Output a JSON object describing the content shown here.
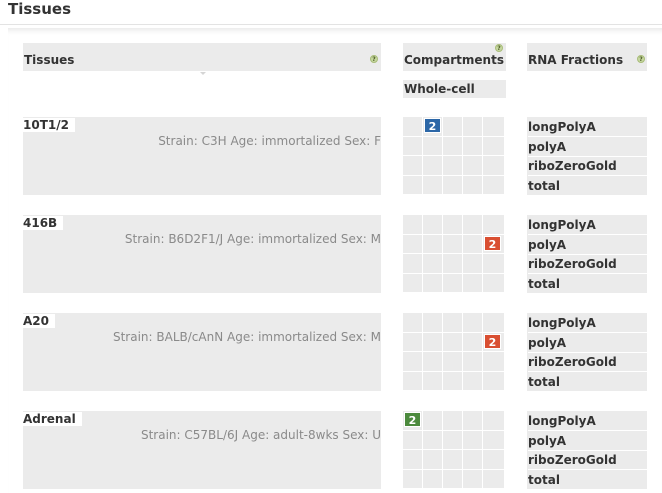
{
  "page": {
    "title": "Tissues"
  },
  "header": {
    "tissues_label": "Tissues",
    "compartments_label": "Compartments",
    "rna_label": "RNA Fractions",
    "help_glyph": "?",
    "compartment_column": "Whole-cell"
  },
  "colors": {
    "blue": "#2c67a7",
    "red": "#d94f32",
    "green": "#4c8a3d",
    "header_bg": "#ebebeb"
  },
  "rows": [
    {
      "name": "10T1/2",
      "desc": "Strain: C3H Age: immortalized Sex: F",
      "fractions": [
        "longPolyA",
        "polyA",
        "riboZeroGold",
        "total"
      ],
      "badge": {
        "text": "2",
        "color": "blue",
        "row": 0,
        "col": 1
      }
    },
    {
      "name": "416B",
      "desc": "Strain: B6D2F1/J Age: immortalized Sex: M",
      "fractions": [
        "longPolyA",
        "polyA",
        "riboZeroGold",
        "total"
      ],
      "badge": {
        "text": "2",
        "color": "red",
        "row": 1,
        "col": 4
      }
    },
    {
      "name": "A20",
      "desc": "Strain: BALB/cAnN Age: immortalized Sex: M",
      "fractions": [
        "longPolyA",
        "polyA",
        "riboZeroGold",
        "total"
      ],
      "badge": {
        "text": "2",
        "color": "red",
        "row": 1,
        "col": 4
      }
    },
    {
      "name": "Adrenal",
      "desc": "Strain: C57BL/6J Age: adult-8wks Sex: U",
      "fractions": [
        "longPolyA",
        "polyA",
        "riboZeroGold",
        "total"
      ],
      "badge": {
        "text": "2",
        "color": "green",
        "row": 0,
        "col": 0
      }
    }
  ]
}
